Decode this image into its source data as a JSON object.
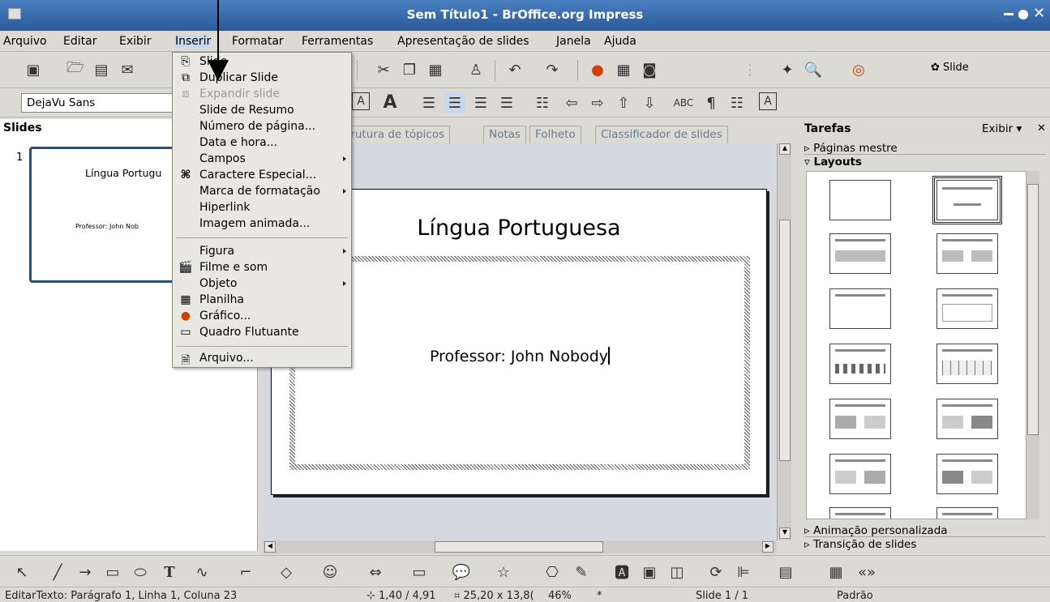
{
  "window": {
    "title": "Sem Título1 - BrOffice.org Impress"
  },
  "menubar": [
    "Arquivo",
    "Editar",
    "Exibir",
    "Inserir",
    "Formatar",
    "Ferramentas",
    "Apresentação de slides",
    "Janela",
    "Ajuda"
  ],
  "toolbar2": {
    "font_name": "DejaVu Sans",
    "slide_button": "Slide"
  },
  "slides_panel": {
    "title": "Slides",
    "thumb_number": "1",
    "thumb_title": "Língua Portugu",
    "thumb_sub": "Professor: John Nob"
  },
  "view_tabs": [
    "trutura de tópicos",
    "Notas",
    "Folheto",
    "Classificador de slides"
  ],
  "slide": {
    "title": "Língua Portuguesa",
    "subtitle": "Professor: John Nobody"
  },
  "insert_menu": {
    "items": [
      {
        "label": "Slide",
        "icon": "slide-icon"
      },
      {
        "label": "Duplicar Slide",
        "icon": "duplicate-icon"
      },
      {
        "label": "Expandir slide",
        "icon": "expand-icon",
        "disabled": true
      },
      {
        "label": "Slide de Resumo"
      },
      {
        "label": "Número de página..."
      },
      {
        "label": "Data e hora..."
      },
      {
        "label": "Campos",
        "submenu": true
      },
      {
        "label": "Caractere Especial...",
        "icon": "special-char-icon"
      },
      {
        "label": "Marca de formatação",
        "submenu": true
      },
      {
        "label": "Hiperlink"
      },
      {
        "label": "Imagem animada..."
      },
      {
        "label": "Figura",
        "submenu": true
      },
      {
        "label": "Filme e som",
        "icon": "film-icon"
      },
      {
        "label": "Objeto",
        "submenu": true
      },
      {
        "label": "Planilha",
        "icon": "spreadsheet-icon"
      },
      {
        "label": "Gráfico...",
        "icon": "chart-icon"
      },
      {
        "label": "Quadro Flutuante",
        "icon": "frame-icon"
      },
      {
        "label": "Arquivo...",
        "icon": "file-icon"
      }
    ]
  },
  "tasks_panel": {
    "title": "Tarefas",
    "view_label": "Exibir",
    "sections": [
      "Páginas mestre",
      "Layouts"
    ],
    "bottom_sections": [
      "Animação personalizada",
      "Transição de slides"
    ]
  },
  "statusbar": {
    "text": "EditarTexto: Parágrafo 1, Linha 1, Coluna 23",
    "position": "1,40 / 4,91",
    "size": "25,20 x 13,8(",
    "zoom": "46%",
    "modified": "*",
    "slide": "Slide 1 / 1",
    "layout": "Padrão"
  }
}
